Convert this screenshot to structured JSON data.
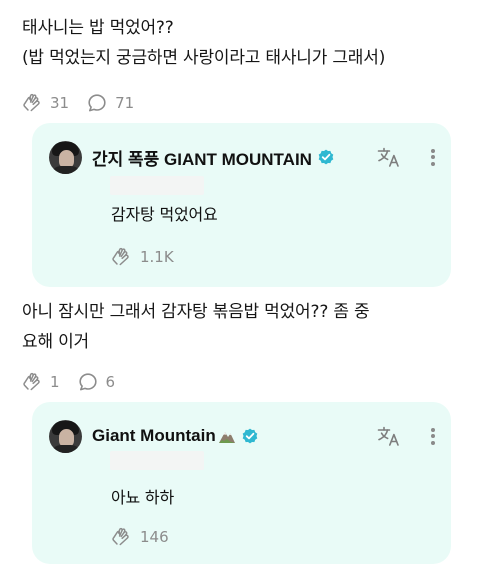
{
  "post1": {
    "lines": [
      "태사니는 밥 먹었어??",
      "(밥 먹었는지 궁금하면 사랑이라고 태사니가 그래서)"
    ],
    "likes": "31",
    "comments": "71"
  },
  "reply1": {
    "author": "간지 폭풍 GIANT MOUNTAIN",
    "text": "감자탕 먹었어요",
    "likes": "1.1K"
  },
  "post2": {
    "lines": [
      "아니 잠시만 그래서 감자탕 볶음밥 먹었어?? 좀 중",
      "요해 이거"
    ],
    "likes": "1",
    "comments": "6"
  },
  "reply2": {
    "author": "Giant Mountain",
    "text": "아뇨 하하",
    "likes": "146"
  },
  "colors": {
    "card_bg": "#e9fbf7",
    "verified": "#2fb8d1",
    "meta_gray": "#8c8c8c"
  },
  "icons": [
    "like-hands-icon",
    "comment-bubble-icon",
    "translate-icon",
    "more-dots-icon",
    "verified-badge-icon",
    "mountain-emoji-icon"
  ]
}
